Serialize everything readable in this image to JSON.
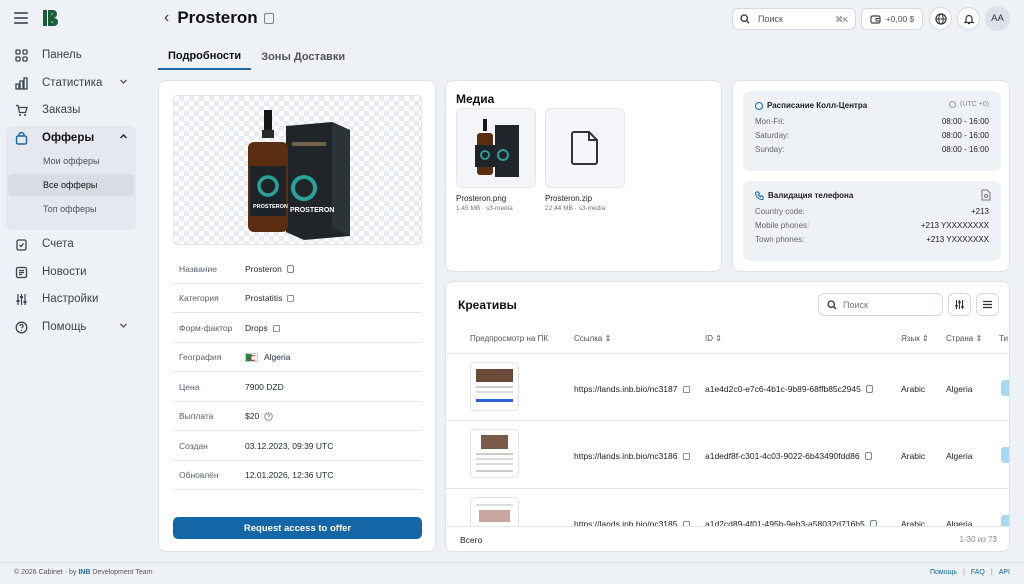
{
  "sidebar": {
    "items": [
      {
        "label": "Панель"
      },
      {
        "label": "Статистика"
      },
      {
        "label": "Заказы"
      },
      {
        "label": "Офферы",
        "sub": [
          "Мои офферы",
          "Все офферы",
          "Топ офферы"
        ]
      },
      {
        "label": "Счета"
      },
      {
        "label": "Новости"
      },
      {
        "label": "Настройки"
      },
      {
        "label": "Помощь"
      }
    ]
  },
  "header": {
    "title": "Prosteron",
    "search_placeholder": "Поиск",
    "search_shortcut": "⌘K",
    "balance": "+0,00 $",
    "avatar_initials": "AA"
  },
  "tabs": [
    "Подробности",
    "Зоны Доставки"
  ],
  "product": {
    "image_brand": "PROSTERON",
    "properties": [
      {
        "key": "Название",
        "value": "Prosteron"
      },
      {
        "key": "Категория",
        "value": "Prostatitis"
      },
      {
        "key": "Форм-фактор",
        "value": "Drops"
      },
      {
        "key": "География",
        "value": "Algeria"
      },
      {
        "key": "Цена",
        "value": "7900 DZD"
      },
      {
        "key": "Выплата",
        "value": "$20"
      },
      {
        "key": "Создан",
        "value": "03.12.2023, 09:39 UTC"
      },
      {
        "key": "Обновлён",
        "value": "12.01.2026, 12:36 UTC"
      }
    ],
    "request_button": "Request access to offer"
  },
  "media": {
    "title": "Медиа",
    "files": [
      {
        "name": "Prosteron.png",
        "meta": "1.45 MB · s3-media"
      },
      {
        "name": "Prosteron.zip",
        "meta": "22.44 MB · s3-media"
      }
    ]
  },
  "callcenter": {
    "title": "Расписание Колл-Центра",
    "timezone": "(UTC +0)",
    "rows": [
      {
        "day": "Mon-Fri:",
        "hours": "08:00 - 16:00"
      },
      {
        "day": "Saturday:",
        "hours": "08:00 - 16:00"
      },
      {
        "day": "Sunday:",
        "hours": "08:00 - 16:00"
      }
    ]
  },
  "phone_validation": {
    "title": "Валидация телефона",
    "rows": [
      {
        "label": "Country code:",
        "value": "+213"
      },
      {
        "label": "Mobile phones:",
        "value": "+213 YXXXXXXXX"
      },
      {
        "label": "Town phones:",
        "value": "+213 YXXXXXXX"
      }
    ]
  },
  "creatives": {
    "title": "Креативы",
    "search_placeholder": "Поиск",
    "columns": [
      "Предпросмотр на ПК",
      "Ссылка",
      "ID",
      "Язык",
      "Страна",
      "Ти"
    ],
    "rows": [
      {
        "link": "https://lands.inb.bio/nc3187",
        "id": "a1e4d2c0-e7c6-4b1c-9b89-68ffb85c2945",
        "lang": "Arabic",
        "country": "Algeria"
      },
      {
        "link": "https://lands.inb.bio/nc3186",
        "id": "a1dedf8f-c301-4c03-9022-6b43490fdd86",
        "lang": "Arabic",
        "country": "Algeria"
      },
      {
        "link": "https://lands.inb.bio/nc3185",
        "id": "a1d2cd89-4f01-495b-9eb3-a58032d716b5",
        "lang": "Arabic",
        "country": "Algeria"
      }
    ],
    "footer_label": "Всего",
    "footer_range": "1-30 из 73"
  },
  "footer": {
    "copyright_prefix": "© 2026 Cabinet · by",
    "brand": "INB",
    "copyright_suffix": "Development Team",
    "links": [
      "Помощь",
      "FAQ",
      "API"
    ]
  },
  "colors": {
    "accent": "#1466a6",
    "active_tab": "#1f6aa5",
    "tag": "#a8d8f2"
  }
}
